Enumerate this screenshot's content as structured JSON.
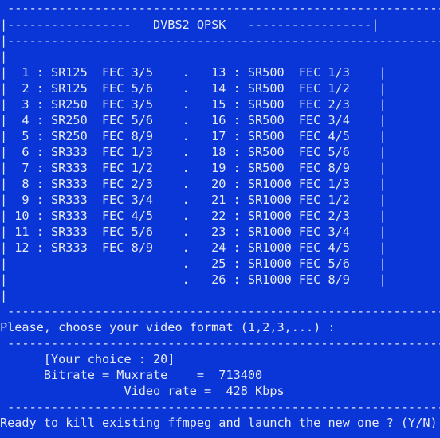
{
  "terminal": {
    "lines": [
      " -------------------------------------------------------------",
      "|-----------------   DVBS2 QPSK   -----------------|",
      "|-------------------------------------------------------------|",
      "|                                                             |",
      "|  1 : SR125  FEC 3/5    .   13 : SR500  FEC 1/3    |",
      "|  2 : SR125  FEC 5/6    .   14 : SR500  FEC 1/2    |",
      "|  3 : SR250  FEC 3/5    .   15 : SR500  FEC 2/3    |",
      "|  4 : SR250  FEC 5/6    .   16 : SR500  FEC 3/4    |",
      "|  5 : SR250  FEC 8/9    .   17 : SR500  FEC 4/5    |",
      "|  6 : SR333  FEC 1/3    .   18 : SR500  FEC 5/6    |",
      "|  7 : SR333  FEC 1/2    .   19 : SR500  FEC 8/9    |",
      "|  8 : SR333  FEC 2/3    .   20 : SR1000 FEC 1/3    |",
      "|  9 : SR333  FEC 3/4    .   21 : SR1000 FEC 1/2    |",
      "| 10 : SR333  FEC 4/5    .   22 : SR1000 FEC 2/3    |",
      "| 11 : SR333  FEC 5/6    .   23 : SR1000 FEC 3/4    |",
      "| 12 : SR333  FEC 8/9    .   24 : SR1000 FEC 4/5    |",
      "|                        .   25 : SR1000 FEC 5/6    |",
      "|                        .   26 : SR1000 FEC 8/9    |",
      "|                                                             |",
      " -------------------------------------------------------------",
      "Please, choose your video format (1,2,3,...) :",
      " -------------------------------------------------------------",
      "      [Your choice : 20]",
      "      Bitrate = Muxrate    =  713400",
      "                 Video rate =  428 Kbps",
      " -------------------------------------------------------------",
      "Ready to kill existing ffmpeg and launch the new one ? (Y/N)"
    ]
  }
}
